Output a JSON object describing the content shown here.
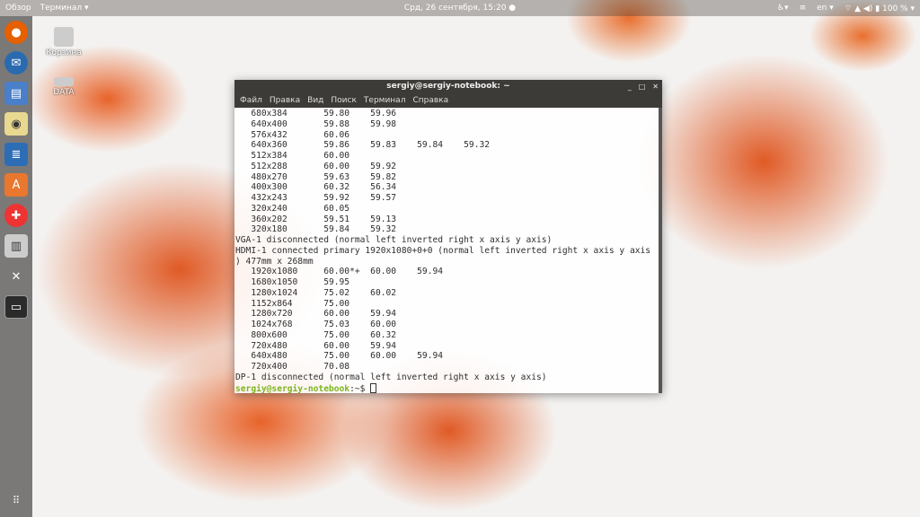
{
  "topbar": {
    "overview": "Обзор",
    "app_menu": "Терминал ▾",
    "clock": "Срд, 26 сентября, 15:20 ●",
    "lang": "en ▾",
    "battery": "100 % ▾"
  },
  "desktop": {
    "icons": [
      {
        "label": "Корзина"
      },
      {
        "label": "DATA"
      }
    ]
  },
  "terminal": {
    "title": "sergiy@sergiy-notebook: ~",
    "menu": [
      "Файл",
      "Правка",
      "Вид",
      "Поиск",
      "Терминал",
      "Справка"
    ],
    "lines": [
      "   680x384       59.80    59.96",
      "   640x400       59.88    59.98",
      "   576x432       60.06",
      "   640x360       59.86    59.83    59.84    59.32",
      "   512x384       60.00",
      "   512x288       60.00    59.92",
      "   480x270       59.63    59.82",
      "   400x300       60.32    56.34",
      "   432x243       59.92    59.57",
      "   320x240       60.05",
      "   360x202       59.51    59.13",
      "   320x180       59.84    59.32",
      "VGA-1 disconnected (normal left inverted right x axis y axis)",
      "HDMI-1 connected primary 1920x1080+0+0 (normal left inverted right x axis y axis",
      ") 477mm x 268mm",
      "   1920x1080     60.00*+  60.00    59.94",
      "   1680x1050     59.95",
      "   1280x1024     75.02    60.02",
      "   1152x864      75.00",
      "   1280x720      60.00    59.94",
      "   1024x768      75.03    60.00",
      "   800x600       75.00    60.32",
      "   720x480       60.00    59.94",
      "   640x480       75.00    60.00    59.94",
      "   720x400       70.08",
      "DP-1 disconnected (normal left inverted right x axis y axis)"
    ],
    "prompt": "sergiy@sergiy-notebook",
    "prompt_suffix": ":~$ "
  }
}
